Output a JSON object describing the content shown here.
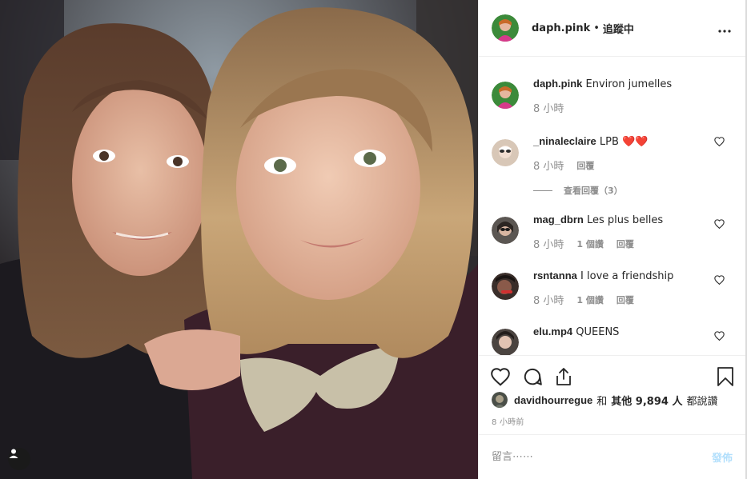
{
  "header": {
    "username": "daph.pink",
    "separator": "•",
    "follow_status": "追蹤中",
    "more_icon": "more-horizontal-icon"
  },
  "comments": [
    {
      "username": "daph.pink",
      "text": "Environ jumelles",
      "time": "8 小時",
      "avatar_color": "#3c8a3a",
      "has_like": false
    },
    {
      "username": "_ninaleclaire",
      "text": "LPB ❤️❤️",
      "time": "8 小時",
      "reply_label": "回覆",
      "view_replies": "查看回覆（3）",
      "avatar_color": "#d8c7b7",
      "has_like": true
    },
    {
      "username": "mag_dbrn",
      "text": "Les plus belles",
      "time": "8 小時",
      "likes_label": "1 個讚",
      "reply_label": "回覆",
      "avatar_color": "#5b5652",
      "has_like": true
    },
    {
      "username": "rsntanna",
      "text": "I love a friendship",
      "time": "8 小時",
      "likes_label": "1 個讚",
      "reply_label": "回覆",
      "avatar_color": "#3a2e2a",
      "has_like": true
    },
    {
      "username": "elu.mp4",
      "text": "QUEENS",
      "avatar_color": "#4b4440",
      "has_like": true
    }
  ],
  "likes": {
    "username": "davidhourregue",
    "and_text": "和",
    "others_text": "其他 9,894 人",
    "suffix": "都說讚"
  },
  "post_time": "8 小時前",
  "comment_box": {
    "placeholder": "留言⋯⋯",
    "post_label": "發佈"
  },
  "colors": {
    "text": "#262626",
    "muted": "#8e8e8e",
    "post_disabled": "#b2dffc",
    "border": "#efefef"
  }
}
